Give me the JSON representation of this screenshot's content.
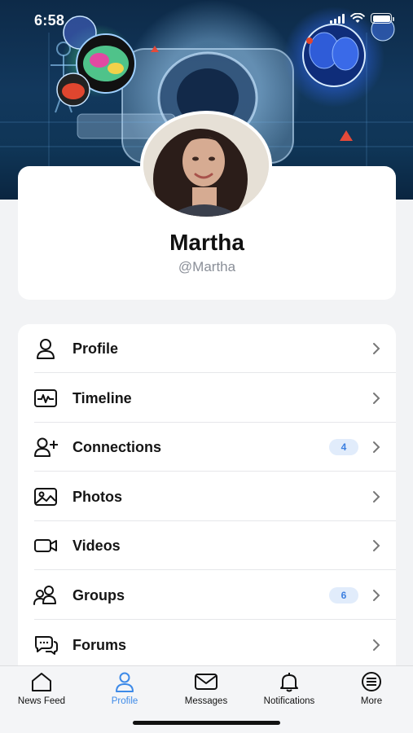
{
  "status_bar": {
    "time": "6:58",
    "icons": [
      "signal-icon",
      "wifi-icon",
      "battery-icon"
    ]
  },
  "cover": {
    "image": "medical-imaging-cover"
  },
  "profile": {
    "name": "Martha",
    "handle": "@Martha",
    "avatar": "profile-photo"
  },
  "menu": {
    "items": [
      {
        "label": "Profile",
        "icon": "user-icon"
      },
      {
        "label": "Timeline",
        "icon": "activity-icon"
      },
      {
        "label": "Connections",
        "icon": "user-plus-icon",
        "badge": "4"
      },
      {
        "label": "Photos",
        "icon": "image-icon"
      },
      {
        "label": "Videos",
        "icon": "video-camera-icon"
      },
      {
        "label": "Groups",
        "icon": "users-icon",
        "badge": "6"
      },
      {
        "label": "Forums",
        "icon": "chat-bubbles-icon"
      }
    ]
  },
  "tab_bar": {
    "active": "Profile",
    "tabs": [
      {
        "label": "News Feed",
        "icon": "home-icon"
      },
      {
        "label": "Profile",
        "icon": "user-icon"
      },
      {
        "label": "Messages",
        "icon": "envelope-icon"
      },
      {
        "label": "Notifications",
        "icon": "bell-icon"
      },
      {
        "label": "More",
        "icon": "menu-list-icon"
      }
    ]
  },
  "colors": {
    "accent": "#3d8ae8",
    "badge_bg": "#e1ecfb",
    "badge_text": "#3c7fe0",
    "page_bg": "#f2f3f5",
    "cover_dark": "#0d2a48"
  }
}
